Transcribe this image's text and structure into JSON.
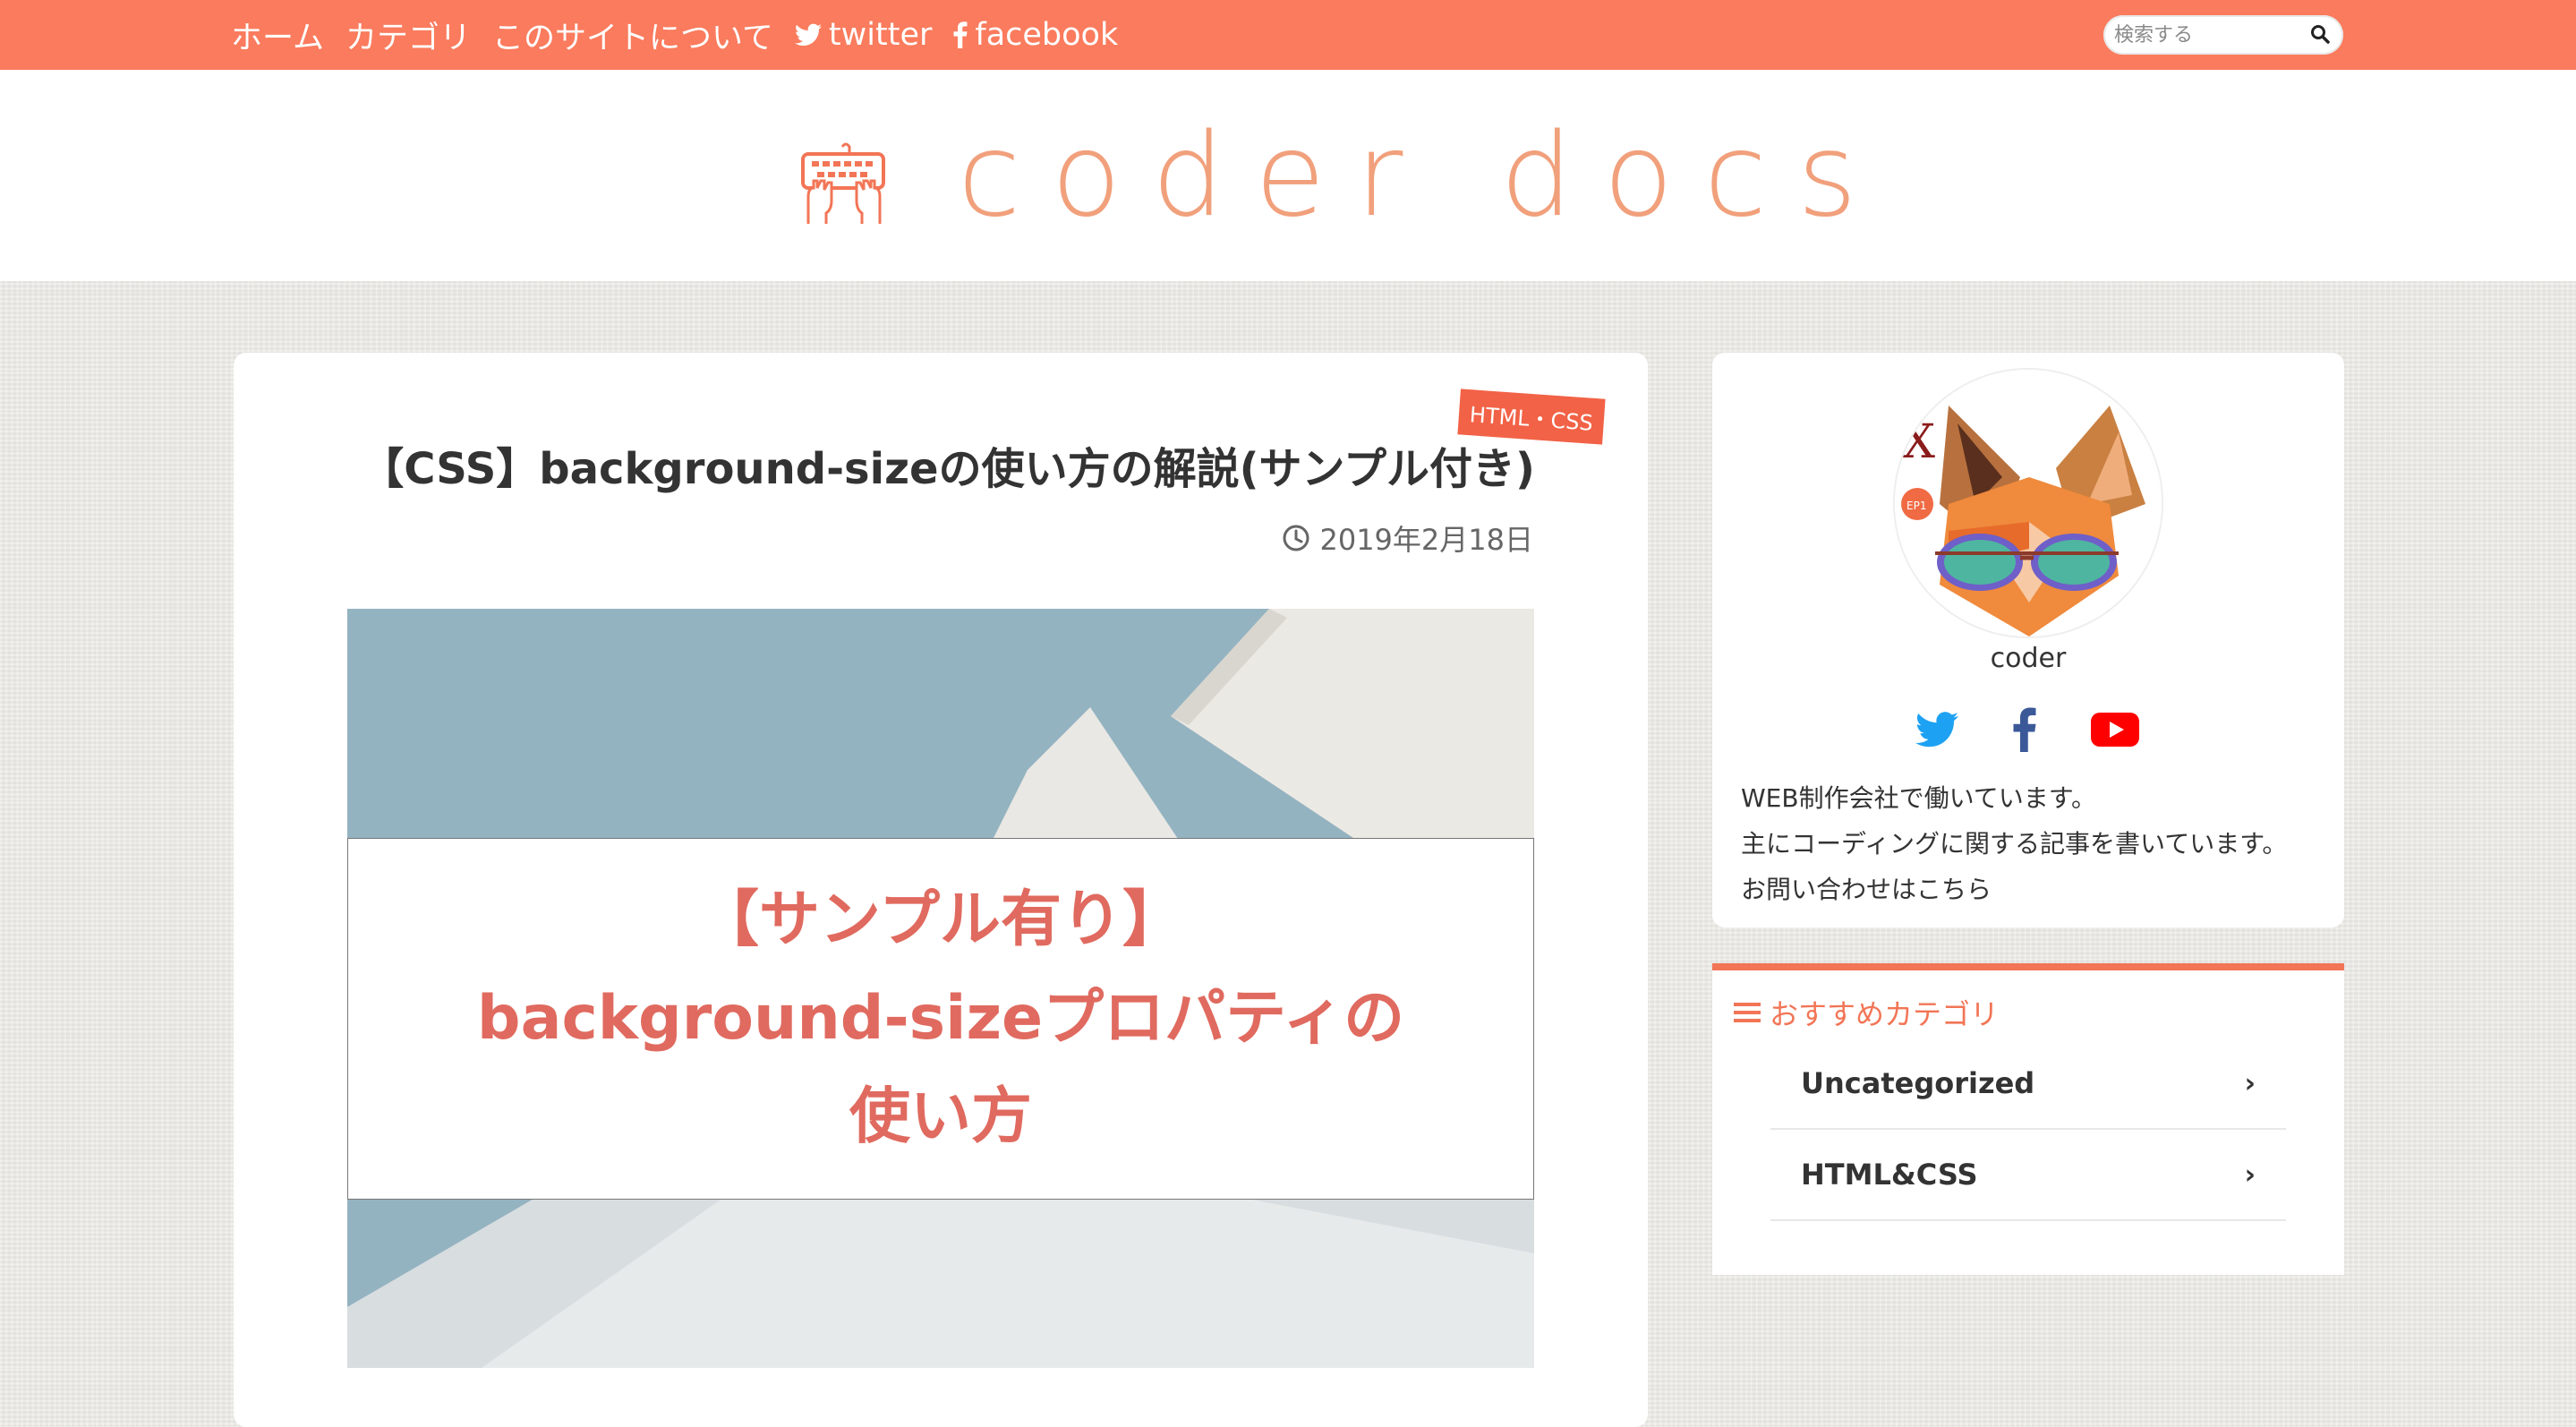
{
  "nav": {
    "items": [
      {
        "label": "ホーム"
      },
      {
        "label": "カテゴリ"
      },
      {
        "label": "このサイトについて"
      },
      {
        "label": "twitter",
        "icon": "twitter-icon"
      },
      {
        "label": "facebook",
        "icon": "facebook-icon"
      }
    ]
  },
  "search": {
    "placeholder": "検索する",
    "icon": "search-icon"
  },
  "site": {
    "logo_text": "coder docs",
    "logo_icon": "keyboard-hands-icon"
  },
  "post": {
    "category": "HTML・CSS",
    "title": "【CSS】background-sizeの使い方の解説(サンプル付き)",
    "date": "2019年2月18日",
    "hero_lines": [
      "【サンプル有り】",
      "background-sizeプロパティの",
      "使い方"
    ]
  },
  "profile": {
    "name": "coder",
    "bio": [
      "WEB制作会社で働いています。",
      "主にコーディングに関する記事を書いています。",
      "お問い合わせはこちら"
    ],
    "social_icons": [
      "twitter-icon",
      "facebook-icon",
      "youtube-icon"
    ]
  },
  "categories": {
    "heading": "おすすめカテゴリ",
    "items": [
      {
        "label": "Uncategorized"
      },
      {
        "label": "HTML&CSS"
      }
    ]
  },
  "colors": {
    "accent": "#fa7b5d",
    "badge": "#f26246",
    "hero_text": "#e06a5f",
    "twitter": "#1da1f2",
    "facebook": "#3b5998",
    "youtube": "#ff0000"
  }
}
